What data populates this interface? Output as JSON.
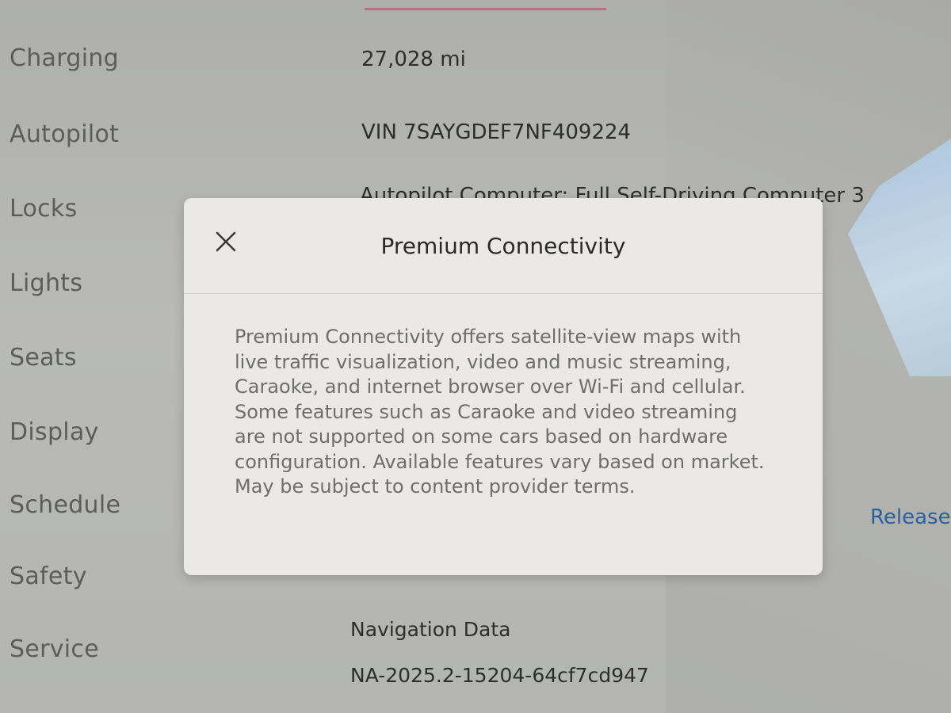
{
  "sidebar": {
    "items": [
      {
        "label": "Charging"
      },
      {
        "label": "Autopilot"
      },
      {
        "label": "Locks"
      },
      {
        "label": "Lights"
      },
      {
        "label": "Seats"
      },
      {
        "label": "Display"
      },
      {
        "label": "Schedule"
      },
      {
        "label": "Safety"
      },
      {
        "label": "Service"
      }
    ]
  },
  "vehicle": {
    "odometer": "27,028 mi",
    "vin": "VIN 7SAYGDEF7NF409224",
    "autopilot_computer": "Autopilot Computer: Full Self-Driving Computer 3",
    "navigation_label": "Navigation Data",
    "navigation_version": "NA-2025.2-15204-64cf7cd947",
    "release_link": "Release"
  },
  "modal": {
    "title": "Premium Connectivity",
    "body": "Premium Connectivity offers satellite-view maps with live traffic visualization, video and music streaming, Caraoke, and internet browser over Wi-Fi and cellular. Some features such as Caraoke and video streaming are not supported on some cars based on hardware configuration. Available features vary based on market. May be subject to content provider terms.",
    "close_icon": "close-icon"
  },
  "colors": {
    "background": "#b7b8b5",
    "modal_background": "#eae9e6",
    "link": "#2c5f9e",
    "accent": "#c0556a"
  }
}
